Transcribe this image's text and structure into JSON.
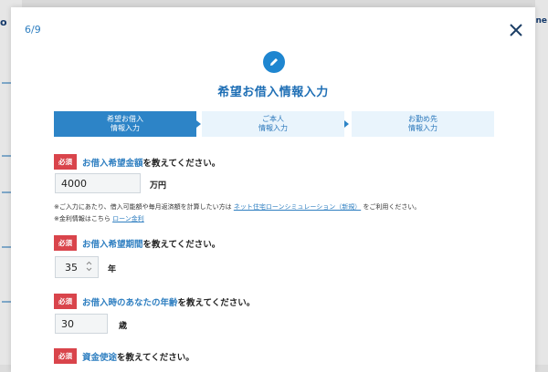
{
  "background": {
    "logo_left": "o",
    "logo_right": "ne"
  },
  "modal": {
    "step_counter": "6/9",
    "title": "希望お借入情報入力",
    "steps": [
      {
        "line1": "希望お借入",
        "line2": "情報入力"
      },
      {
        "line1": "ご本人",
        "line2": "情報入力"
      },
      {
        "line1": "お勤め先",
        "line2": "情報入力"
      }
    ],
    "required_label": "必須",
    "q_amount": {
      "label": "お借入希望金額",
      "suffix": "を教えてください。"
    },
    "amount_value": "4000",
    "amount_unit": "万円",
    "note1_pre": "※ご入力にあたり、借入可能額や毎月返済額を計算したい方は",
    "note1_link": "ネット住宅ローンシミュレーション（新規）",
    "note1_post": "をご利用ください。",
    "note2_pre": "※金利情報はこちら",
    "note2_link": "ローン金利",
    "q_period": {
      "label": "お借入希望期間",
      "suffix": "を教えてください。"
    },
    "period_value": "35",
    "period_unit": "年",
    "q_age": {
      "label": "お借入時のあなたの年齢",
      "suffix": "を教えてください。"
    },
    "age_value": "30",
    "age_unit": "歳",
    "q_purpose": {
      "label": "資金使途",
      "suffix": "を教えてください。"
    }
  },
  "colors": {
    "accent": "#2d84c7",
    "required": "#d9444b",
    "link": "#2f7fc1"
  },
  "icons": [
    "pencil-icon",
    "close-icon",
    "stepper-icon"
  ]
}
